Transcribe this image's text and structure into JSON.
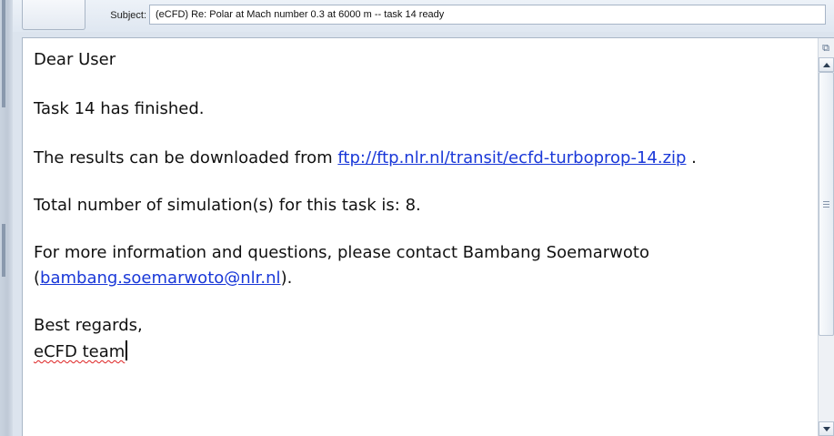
{
  "subject": {
    "label": "Subject:",
    "value": "(eCFD) Re: Polar at Mach number 0.3 at 6000 m -- task 14 ready"
  },
  "message": {
    "greeting": "Dear User",
    "line1": "Task 14 has finished.",
    "line2_prefix": "The results can be downloaded from ",
    "line2_link": "ftp://ftp.nlr.nl/transit/ecfd-turboprop-14.zip",
    "line2_suffix": " .",
    "line3": "Total number of simulation(s) for this task is: 8.",
    "line4": "For more information and questions, please contact Bambang Soemarwoto",
    "line5_prefix": "(",
    "line5_link": "bambang.soemarwoto@nlr.nl",
    "line5_suffix": ").",
    "closing": "Best regards,",
    "signature": "eCFD team"
  },
  "scrollbar": {
    "icon": "expand-reading-pane-icon"
  }
}
